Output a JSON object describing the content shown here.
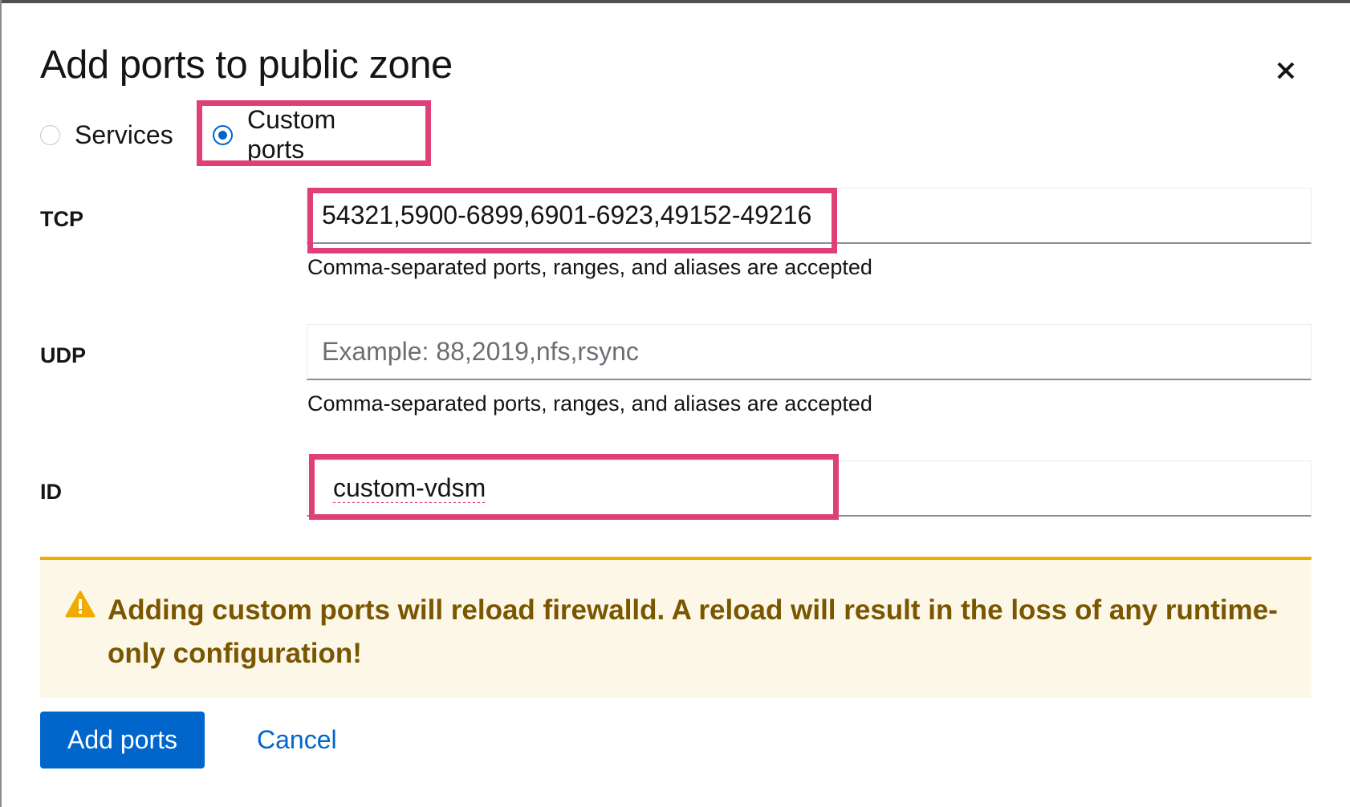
{
  "dialog": {
    "title": "Add ports to public zone",
    "close_icon": "close-icon"
  },
  "mode_options": [
    {
      "label": "Services",
      "selected": false
    },
    {
      "label": "Custom ports",
      "selected": true
    }
  ],
  "fields": {
    "tcp": {
      "label": "TCP",
      "value": "54321,5900-6899,6901-6923,49152-49216",
      "placeholder": "",
      "helper": "Comma-separated ports, ranges, and aliases are accepted"
    },
    "udp": {
      "label": "UDP",
      "value": "",
      "placeholder": "Example: 88,2019,nfs,rsync",
      "helper": "Comma-separated ports, ranges, and aliases are accepted"
    },
    "id": {
      "label": "ID",
      "value": "custom-vdsm"
    }
  },
  "alert": {
    "icon": "warning-icon",
    "message": "Adding custom ports will reload firewalld. A reload will result in the loss of any runtime-only configuration!"
  },
  "actions": {
    "primary_label": "Add ports",
    "cancel_label": "Cancel"
  },
  "colors": {
    "primary": "#0066cc",
    "highlight": "#e0407a",
    "warning": "#f0ab00",
    "warning_text": "#795600",
    "warning_bg": "#fdf7e7"
  }
}
